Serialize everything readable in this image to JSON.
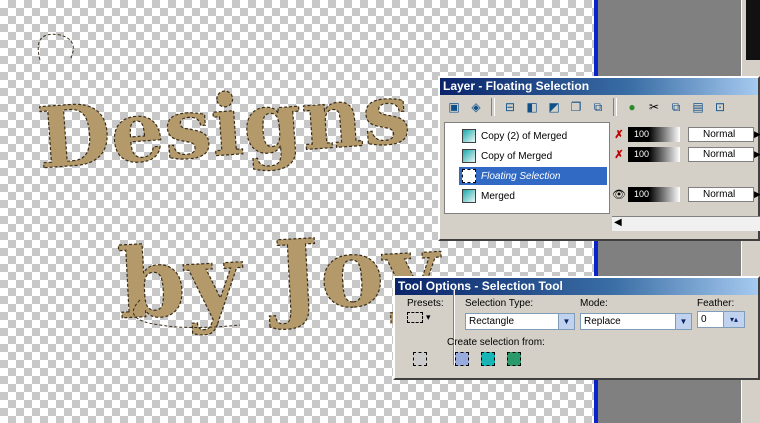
{
  "canvas_text": {
    "line1": "Designs",
    "line2": "by Joy"
  },
  "layers_window": {
    "title": "Layer - Floating Selection",
    "toolbar_icons": [
      "new-raster-layer-icon",
      "new-vector-layer-icon",
      "new-group-icon",
      "new-mask-icon",
      "new-adjustment-icon",
      "duplicate-layer-icon",
      "promote-layer-icon",
      "layer-properties-icon",
      "color-icon",
      "delete-layer-icon",
      "copy-icon",
      "paste-icon",
      "collapse-icon"
    ],
    "layers": [
      {
        "name": "Copy (2) of Merged",
        "visible": false,
        "opacity": "100",
        "blend": "Normal",
        "selected": false
      },
      {
        "name": "Copy of Merged",
        "visible": false,
        "opacity": "100",
        "blend": "Normal",
        "selected": false
      },
      {
        "name": "Floating Selection",
        "visible": true,
        "opacity": "",
        "blend": "",
        "selected": true
      },
      {
        "name": "Merged",
        "visible": true,
        "opacity": "100",
        "blend": "Normal",
        "selected": false
      }
    ]
  },
  "tool_options": {
    "title": "Tool Options - Selection Tool",
    "presets_label": "Presets:",
    "selection_type_label": "Selection Type:",
    "selection_type_value": "Rectangle",
    "mode_label": "Mode:",
    "mode_value": "Replace",
    "feather_label": "Feather:",
    "feather_value": "0",
    "create_from_label": "Create selection from:"
  }
}
